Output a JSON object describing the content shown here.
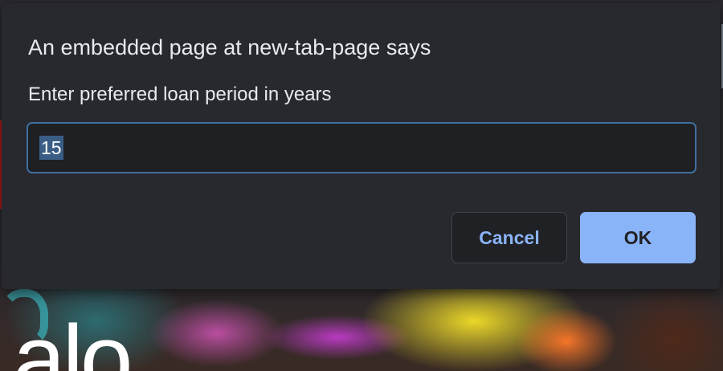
{
  "dialog": {
    "title": "An embedded page at new-tab-page says",
    "message": "Enter preferred loan period in years",
    "input_value": "15",
    "cancel_label": "Cancel",
    "ok_label": "OK"
  },
  "background": {
    "visible_text": "alo"
  },
  "colors": {
    "dialog_bg": "#28292e",
    "accent": "#8ab4f8",
    "input_border": "#3f6f9f",
    "selection": "#3a5d86"
  }
}
